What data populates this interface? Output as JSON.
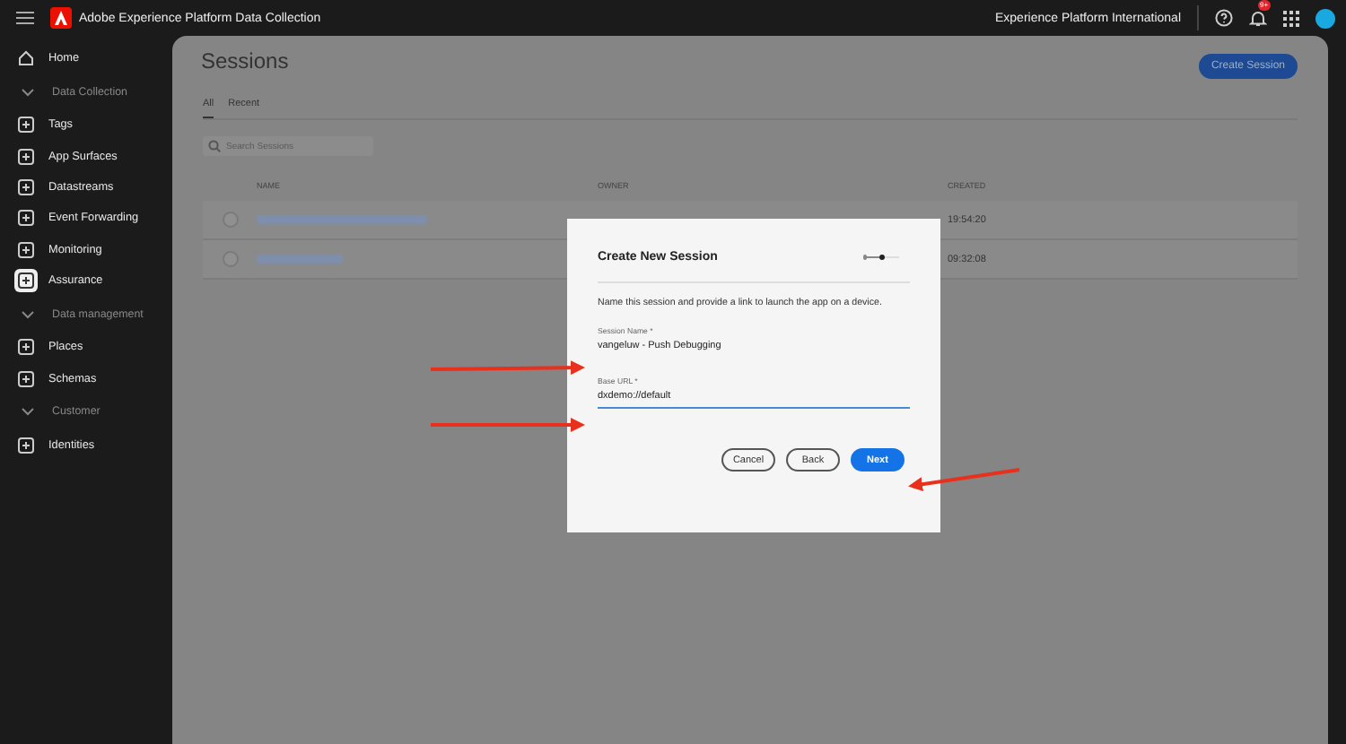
{
  "top_bar": {
    "app_title": "Adobe Experience Platform Data Collection",
    "org": "Experience Platform International",
    "notification_badge": "9+"
  },
  "sidebar": {
    "items": [
      {
        "kind": "item",
        "label": "Home",
        "selected": false
      },
      {
        "kind": "section",
        "label": "Data Collection"
      },
      {
        "kind": "item",
        "label": "Tags",
        "selected": false
      },
      {
        "kind": "item",
        "label": "App Surfaces",
        "selected": false
      },
      {
        "kind": "item",
        "label": "Datastreams",
        "selected": false
      },
      {
        "kind": "item",
        "label": "Event Forwarding",
        "selected": false
      },
      {
        "kind": "item",
        "label": "Monitoring",
        "selected": false
      },
      {
        "kind": "item",
        "label": "Assurance",
        "selected": true
      },
      {
        "kind": "section",
        "label": "Data management"
      },
      {
        "kind": "item",
        "label": "Places",
        "selected": false
      },
      {
        "kind": "item",
        "label": "Schemas",
        "selected": false
      },
      {
        "kind": "section",
        "label": "Customer"
      },
      {
        "kind": "item",
        "label": "Identities",
        "selected": false
      }
    ]
  },
  "page": {
    "title": "Sessions",
    "create_button": "Create Session",
    "tabs": [
      {
        "label": "All",
        "selected": true
      },
      {
        "label": "Recent",
        "selected": false
      }
    ],
    "search": {
      "placeholder": "Search Sessions"
    },
    "table": {
      "columns": [
        "NAME",
        "OWNER",
        "CREATED"
      ],
      "rows": [
        {
          "selected": false,
          "created": "19:54:20"
        },
        {
          "selected": false,
          "created": "09:32:08"
        }
      ]
    }
  },
  "dialog": {
    "title": "Create New Session",
    "steps": [
      {
        "selected": false
      },
      {
        "selected": true
      }
    ],
    "description": "Name this session and provide a link to launch the app on a device.",
    "fields": [
      {
        "label": "Session Name *",
        "value": "vangeluw - Push Debugging",
        "focused": false
      },
      {
        "label": "Base URL *",
        "value": "dxdemo://default",
        "focused": true
      }
    ],
    "buttons": [
      {
        "label": "Cancel",
        "kind": "secondary"
      },
      {
        "label": "Back",
        "kind": "secondary"
      },
      {
        "label": "Next",
        "kind": "primary"
      }
    ]
  }
}
